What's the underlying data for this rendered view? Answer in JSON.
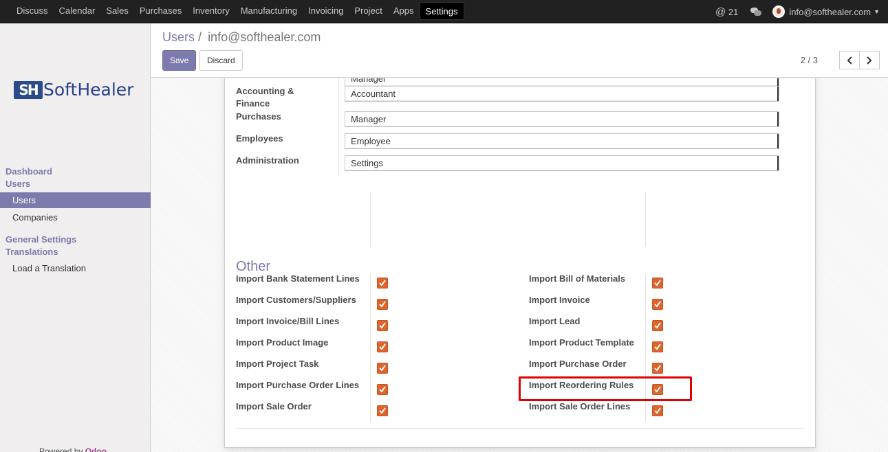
{
  "topbar": {
    "menu": [
      "Discuss",
      "Calendar",
      "Sales",
      "Purchases",
      "Inventory",
      "Manufacturing",
      "Invoicing",
      "Project",
      "Apps",
      "Settings"
    ],
    "active": "Settings",
    "mentions_count": "21",
    "user_email": "info@softhealer.com"
  },
  "sidebar": {
    "logo_mark": "SH",
    "logo_text": "SoftHealer",
    "sections": [
      {
        "label": "Dashboard"
      },
      {
        "label": "Users"
      },
      {
        "label": "General Settings"
      },
      {
        "label": "Translations"
      }
    ],
    "items": [
      {
        "label": "Users",
        "active": true
      },
      {
        "label": "Companies",
        "active": false
      },
      {
        "label": "Load a Translation",
        "active": false
      }
    ],
    "powered_by": "Powered by",
    "powered_brand": "Odoo"
  },
  "control_panel": {
    "breadcrumb_root": "Users",
    "breadcrumb_sep": "/",
    "breadcrumb_current": "info@softhealer.com",
    "save_label": "Save",
    "discard_label": "Discard",
    "pager": "2 / 3"
  },
  "access_rights": [
    {
      "label": "Accounting & Finance",
      "value": "Accountant"
    },
    {
      "label": "Purchases",
      "value": "Manager"
    },
    {
      "label": "Employees",
      "value": "Employee"
    },
    {
      "label": "Administration",
      "value": "Settings"
    }
  ],
  "partial_select_value": "Manager",
  "other": {
    "title": "Other",
    "left": [
      {
        "label": "Import Bank Statement Lines",
        "checked": true
      },
      {
        "label": "Import Customers/Suppliers",
        "checked": true
      },
      {
        "label": "Import Invoice/Bill Lines",
        "checked": true
      },
      {
        "label": "Import Product Image",
        "checked": true
      },
      {
        "label": "Import Project Task",
        "checked": true
      },
      {
        "label": "Import Purchase Order Lines",
        "checked": true
      },
      {
        "label": "Import Sale Order",
        "checked": true
      }
    ],
    "right": [
      {
        "label": "Import Bill of Materials",
        "checked": true
      },
      {
        "label": "Import Invoice",
        "checked": true
      },
      {
        "label": "Import Lead",
        "checked": true
      },
      {
        "label": "Import Product Template",
        "checked": true
      },
      {
        "label": "Import Purchase Order",
        "checked": true
      },
      {
        "label": "Import Reordering Rules",
        "checked": true
      },
      {
        "label": "Import Sale Order Lines",
        "checked": true
      }
    ]
  },
  "colors": {
    "brand": "#7c7bad",
    "checkbox": "#e0622c",
    "highlight": "#e00000"
  }
}
